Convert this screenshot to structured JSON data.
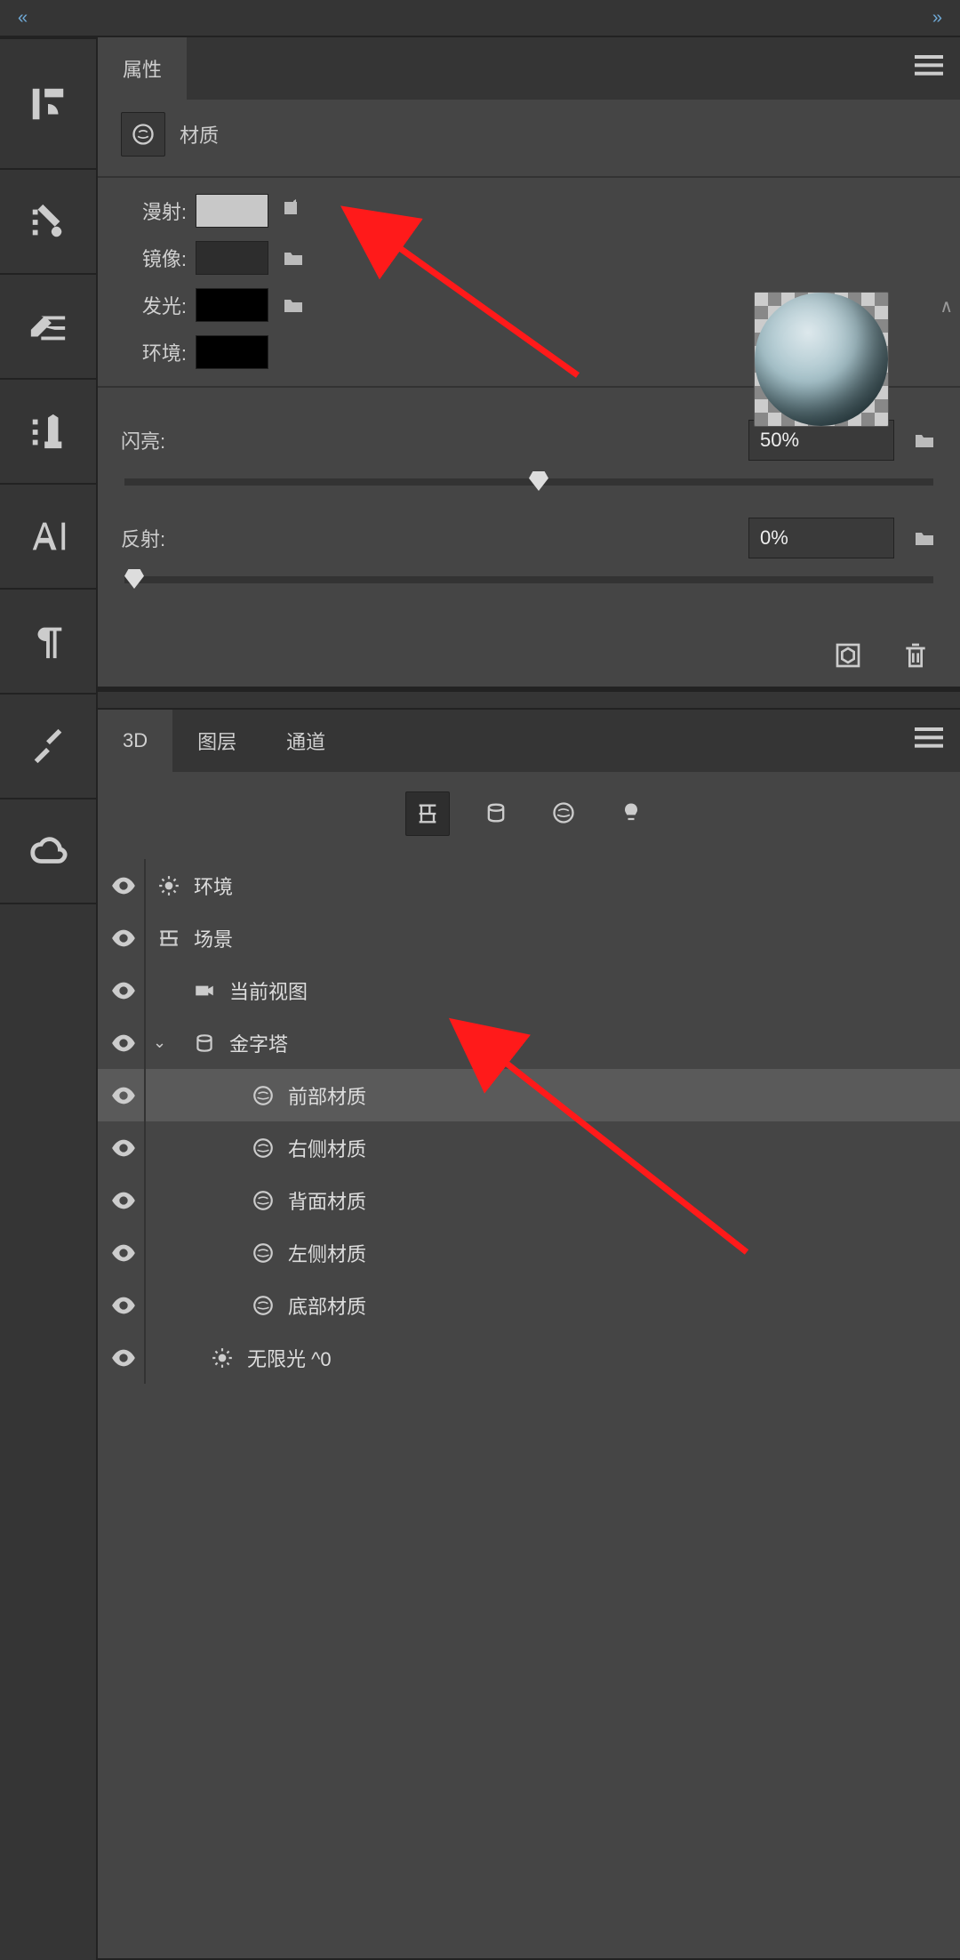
{
  "topbar": {
    "left_chevron": "«",
    "right_chevron": "»"
  },
  "sidebar_icons": [
    "panel-toggle",
    "brush-list",
    "brush-settings",
    "clone-source",
    "type",
    "paragraph",
    "tools",
    "creative-cloud"
  ],
  "properties": {
    "tab_title": "属性",
    "material_label": "材质",
    "rows": {
      "diffuse": "漫射:",
      "mirror": "镜像:",
      "emit": "发光:",
      "env": "环境:"
    },
    "shine_label": "闪亮:",
    "shine_value": "50%",
    "reflect_label": "反射:",
    "reflect_value": "0%"
  },
  "panel2": {
    "tabs": {
      "t3d": "3D",
      "layers": "图层",
      "channels": "通道"
    }
  },
  "tree": {
    "env": "环境",
    "scene": "场景",
    "view": "当前视图",
    "pyramid": "金字塔",
    "mat_front": "前部材质",
    "mat_right": "右侧材质",
    "mat_back": "背面材质",
    "mat_left": "左侧材质",
    "mat_bottom": "底部材质",
    "light": "无限光 ^0"
  }
}
